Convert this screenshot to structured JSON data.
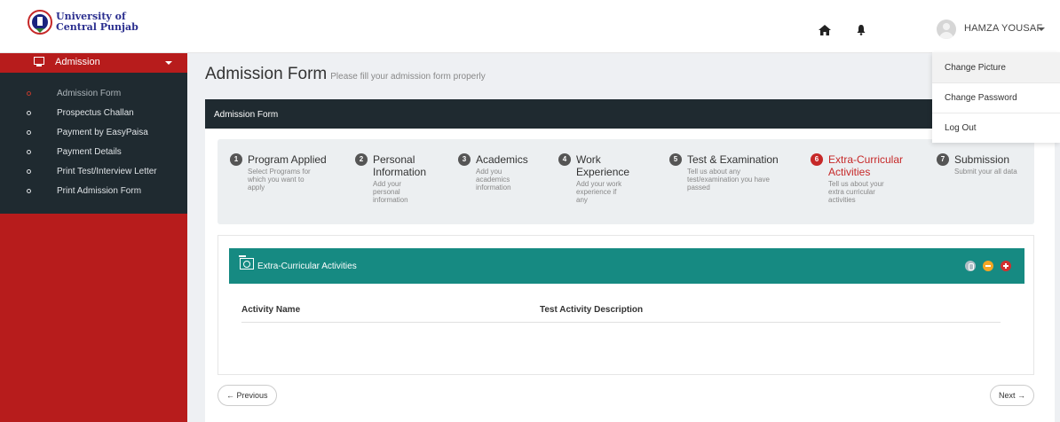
{
  "header": {
    "logo_line1": "University of",
    "logo_line2": "Central Punjab",
    "username": "HAMZA YOUSAF",
    "icons": [
      "home-icon",
      "bell-icon",
      "avatar",
      "caret-down-icon"
    ]
  },
  "sidebar": {
    "section_label": "Admission",
    "items": [
      {
        "label": "Admission Form"
      },
      {
        "label": "Prospectus Challan"
      },
      {
        "label": "Payment by EasyPaisa"
      },
      {
        "label": "Payment Details"
      },
      {
        "label": "Print Test/Interview Letter"
      },
      {
        "label": "Print Admission Form"
      }
    ]
  },
  "main": {
    "title": "Admission Form",
    "subtitle": "Please fill your admission form properly",
    "box_title": "Admission Form",
    "steps": [
      {
        "num": "1",
        "title": "Program Applied",
        "desc": "Select Programs for which you want to apply"
      },
      {
        "num": "2",
        "title": "Personal Information",
        "desc": "Add your personal information"
      },
      {
        "num": "3",
        "title": "Academics",
        "desc": "Add you academics information"
      },
      {
        "num": "4",
        "title": "Work Experience",
        "desc": "Add your work experience if any"
      },
      {
        "num": "5",
        "title": "Test & Examination",
        "desc": "Tell us about any test/examination you have passed"
      },
      {
        "num": "6",
        "title": "Extra-Curricular Activities",
        "desc": "Tell us about your extra curricular activities"
      },
      {
        "num": "7",
        "title": "Submission",
        "desc": "Submit your all data"
      }
    ],
    "panel": {
      "title": "Extra-Curricular Activities",
      "columns": [
        "Activity Name",
        "Test Activity Description"
      ]
    },
    "prev_label": "← Previous",
    "next_label": "Next →"
  },
  "dropdown": {
    "items": [
      "Change Picture",
      "Change Password",
      "Log Out"
    ]
  },
  "colors": {
    "brand_red": "#b71c1c",
    "dark_bar": "#1f2a30",
    "teal": "#168a82",
    "active_step": "#c62828"
  }
}
